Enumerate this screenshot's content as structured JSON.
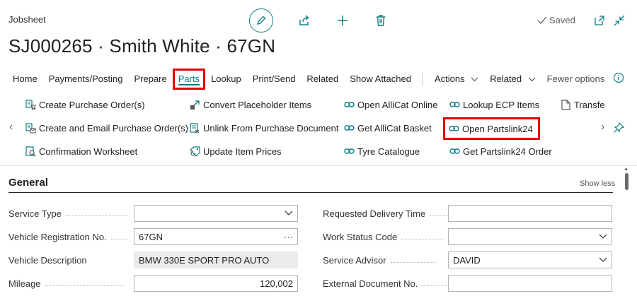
{
  "header": {
    "page_type": "Jobsheet",
    "title": "SJ000265 · Smith White · 67GN",
    "saved_label": "Saved"
  },
  "menu": {
    "items": [
      {
        "label": "Home"
      },
      {
        "label": "Payments/Posting"
      },
      {
        "label": "Prepare"
      },
      {
        "label": "Parts",
        "active": true
      },
      {
        "label": "Lookup"
      },
      {
        "label": "Print/Send"
      },
      {
        "label": "Related"
      },
      {
        "label": "Show Attached"
      }
    ],
    "actions_label": "Actions",
    "related_label": "Related",
    "fewer_label": "Fewer options"
  },
  "ribbon": {
    "col1": [
      {
        "label": "Create Purchase Order(s)",
        "icon": "purchase-order-icon"
      },
      {
        "label": "Create and Email Purchase Order(s)",
        "icon": "email-purchase-order-icon"
      },
      {
        "label": "Confirmation Worksheet",
        "icon": "worksheet-icon"
      }
    ],
    "col2": [
      {
        "label": "Convert Placeholder Items",
        "icon": "convert-icon"
      },
      {
        "label": "Unlink From Purchase Document",
        "icon": "unlink-document-icon"
      },
      {
        "label": "Update Item Prices",
        "icon": "update-prices-icon"
      }
    ],
    "col3": [
      {
        "label": "Open AlliCat Online",
        "icon": "link-icon"
      },
      {
        "label": "Get AlliCat Basket",
        "icon": "link-icon"
      },
      {
        "label": "Tyre Catalogue",
        "icon": "link-icon"
      }
    ],
    "col4": [
      {
        "label": "Lookup ECP Items",
        "icon": "link-icon"
      },
      {
        "label": "Open Partslink24",
        "icon": "link-icon"
      },
      {
        "label": "Get Partslink24 Order",
        "icon": "link-icon"
      }
    ],
    "col5": [
      {
        "label": "Transfe",
        "icon": "document-icon"
      }
    ]
  },
  "general": {
    "title": "General",
    "show_less": "Show less",
    "left_fields": [
      {
        "label": "Service Type",
        "value": "",
        "control": "dropdown"
      },
      {
        "label": "Vehicle Registration No.",
        "value": "67GN",
        "control": "lookup"
      },
      {
        "label": "Vehicle Description",
        "value": "BMW 330E SPORT PRO AUTO",
        "control": "readonly"
      },
      {
        "label": "Mileage",
        "value": "120,002",
        "control": "number"
      }
    ],
    "right_fields": [
      {
        "label": "Requested Delivery Time",
        "value": "",
        "control": "text"
      },
      {
        "label": "Work Status Code",
        "value": "",
        "control": "dropdown"
      },
      {
        "label": "Service Advisor",
        "value": "DAVID",
        "control": "dropdown"
      },
      {
        "label": "External Document No.",
        "value": "",
        "control": "text"
      }
    ]
  },
  "colors": {
    "accent": "#0a7d84",
    "highlight_outline": "#e00000"
  }
}
